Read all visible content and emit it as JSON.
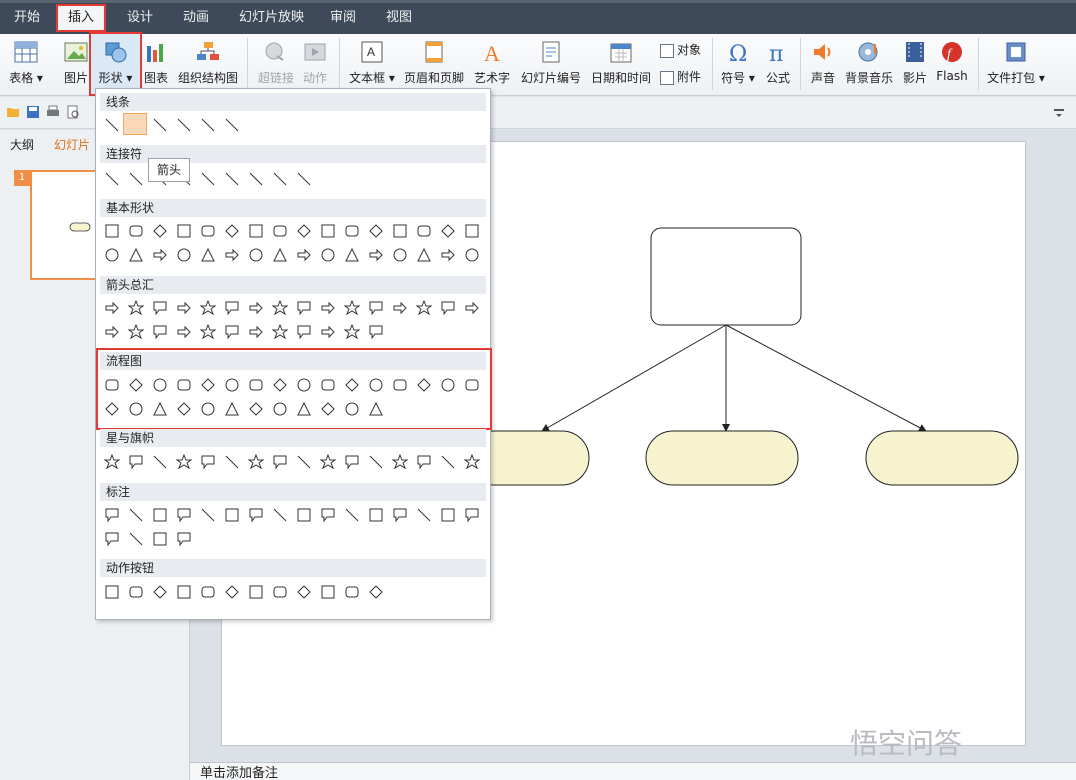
{
  "menu": {
    "items": [
      "开始",
      "插入",
      "设计",
      "动画",
      "幻灯片放映",
      "审阅",
      "视图"
    ],
    "active_index": 1
  },
  "ribbon": {
    "table": "表格",
    "picture": "图片",
    "shapes": "形状",
    "chart": "图表",
    "org_chart": "组织结构图",
    "hyperlink": "超链接",
    "action": "动作",
    "textbox": "文本框",
    "header_footer": "页眉和页脚",
    "wordart": "艺术字",
    "slide_number": "幻灯片编号",
    "datetime": "日期和时间",
    "object": "对象",
    "attachment": "附件",
    "symbol": "符号",
    "formula": "公式",
    "sound": "声音",
    "bg_music": "背景音乐",
    "movie": "影片",
    "flash": "Flash",
    "package": "文件打包"
  },
  "left_pane": {
    "tab_outline": "大纲",
    "tab_slides": "幻灯片",
    "slide_num": "1"
  },
  "dropdown": {
    "sections": [
      "线条",
      "连接符",
      "基本形状",
      "箭头总汇",
      "流程图",
      "星与旗帜",
      "标注",
      "动作按钮"
    ],
    "tooltip": "箭头"
  },
  "notes": "单击添加备注",
  "watermark": "悟空问答",
  "colors": {
    "menubar_bg": "#3e4a59",
    "highlight_red": "#e53935",
    "flow_fill": "#f8f3cf",
    "selection_orange": "#f08d46"
  }
}
